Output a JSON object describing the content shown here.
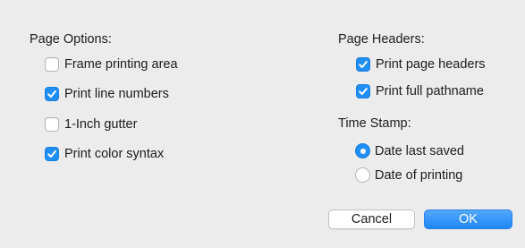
{
  "page_options": {
    "title": "Page Options:",
    "items": [
      {
        "label": "Frame printing area",
        "checked": false
      },
      {
        "label": "Print line numbers",
        "checked": true
      },
      {
        "label": "1-Inch gutter",
        "checked": false
      },
      {
        "label": "Print color syntax",
        "checked": true
      }
    ]
  },
  "page_headers": {
    "title": "Page Headers:",
    "items": [
      {
        "label": "Print page headers",
        "checked": true
      },
      {
        "label": "Print full pathname",
        "checked": true
      }
    ]
  },
  "time_stamp": {
    "title": "Time Stamp:",
    "options": [
      {
        "label": "Date last saved",
        "selected": true
      },
      {
        "label": "Date of printing",
        "selected": false
      }
    ]
  },
  "buttons": {
    "cancel_label": "Cancel",
    "ok_label": "OK"
  },
  "colors": {
    "accent": "#1f8ef5",
    "background": "#ececec"
  }
}
